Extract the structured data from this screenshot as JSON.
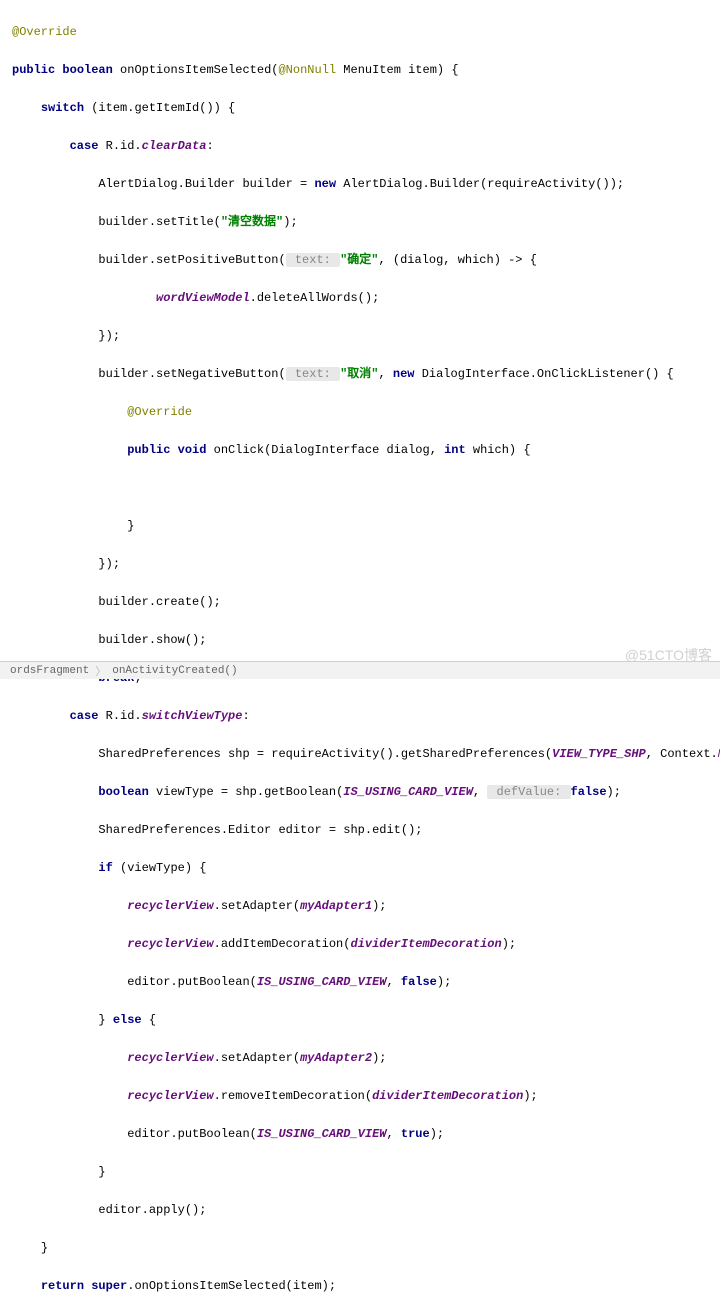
{
  "code": {
    "override": "@Override",
    "public": "public",
    "boolean_kw": "boolean",
    "method_name": "onOptionsItemSelected",
    "nonnull": "@NonNull",
    "param_type": "MenuItem",
    "param_name": "item",
    "switch_kw": "switch",
    "switch_expr": "(item.getItemId()) {",
    "case_kw": "case",
    "r_id": "R.id.",
    "clearData": "clearData",
    "alert_line": "AlertDialog.Builder builder = ",
    "new_kw": "new",
    "alert_ctor": " AlertDialog.Builder(requireActivity());",
    "setTitle_pre": "builder.setTitle(",
    "setTitle_str": "\"清空数据\"",
    "setTitle_post": ");",
    "setPos_pre": "builder.setPositiveButton(",
    "text_hint": " text: ",
    "pos_str": "\"确定\"",
    "lambda_args": ", (dialog, which) -> {",
    "wordViewModel": "wordViewModel",
    "deleteAll": ".deleteAllWords();",
    "close_lambda": "});",
    "setNeg_pre": "builder.setNegativeButton(",
    "neg_str": "\"取消\"",
    "neg_new": " DialogInterface.OnClickListener() {",
    "onclick_pre": " onClick(DialogInterface dialog, ",
    "int_kw": "int",
    "onclick_post": " which) {",
    "void_kw": "void",
    "close_brace": "}",
    "create_line": "builder.create();",
    "show_line": "builder.show();",
    "break_kw": "break",
    "semicolon": ";",
    "switchViewType": "switchViewType",
    "shp_pre": "SharedPreferences shp = requireActivity().getSharedPreferences(",
    "view_type_shp": "VIEW_TYPE_SHP",
    "context_mode": ", Context.",
    "mode_private": "MODE_PRIVATE",
    "close_paren_semi": ");",
    "viewtype_pre": " viewType = shp.getBoolean(",
    "is_using": "IS_USING_CARD_VIEW",
    "defvalue_hint": " defValue: ",
    "false_kw": "false",
    "editor_line": "SharedPreferences.Editor editor = shp.edit();",
    "if_kw": "if",
    "if_cond": " (viewType) {",
    "recyclerView": "recyclerView",
    "setAdapter": ".setAdapter(",
    "myAdapter1": "myAdapter1",
    "myAdapter2": "myAdapter2",
    "addItemDeco": ".addItemDecoration(",
    "removeItemDeco": ".removeItemDecoration(",
    "dividerItemDecoration": "dividerItemDecoration",
    "putBoolean_pre": "editor.putBoolean(",
    "true_kw": "true",
    "else_kw": "else",
    "else_open": " {",
    "apply_line": "editor.apply();",
    "return_kw": "return",
    "super_kw": "super",
    "return_post": ".onOptionsItemSelected(item);",
    "colon": ":",
    "comma_sep": ", "
  },
  "breadcrumb": {
    "item1": "ordsFragment",
    "item2": "onActivityCreated()"
  },
  "watermark": "@51CTO博客"
}
